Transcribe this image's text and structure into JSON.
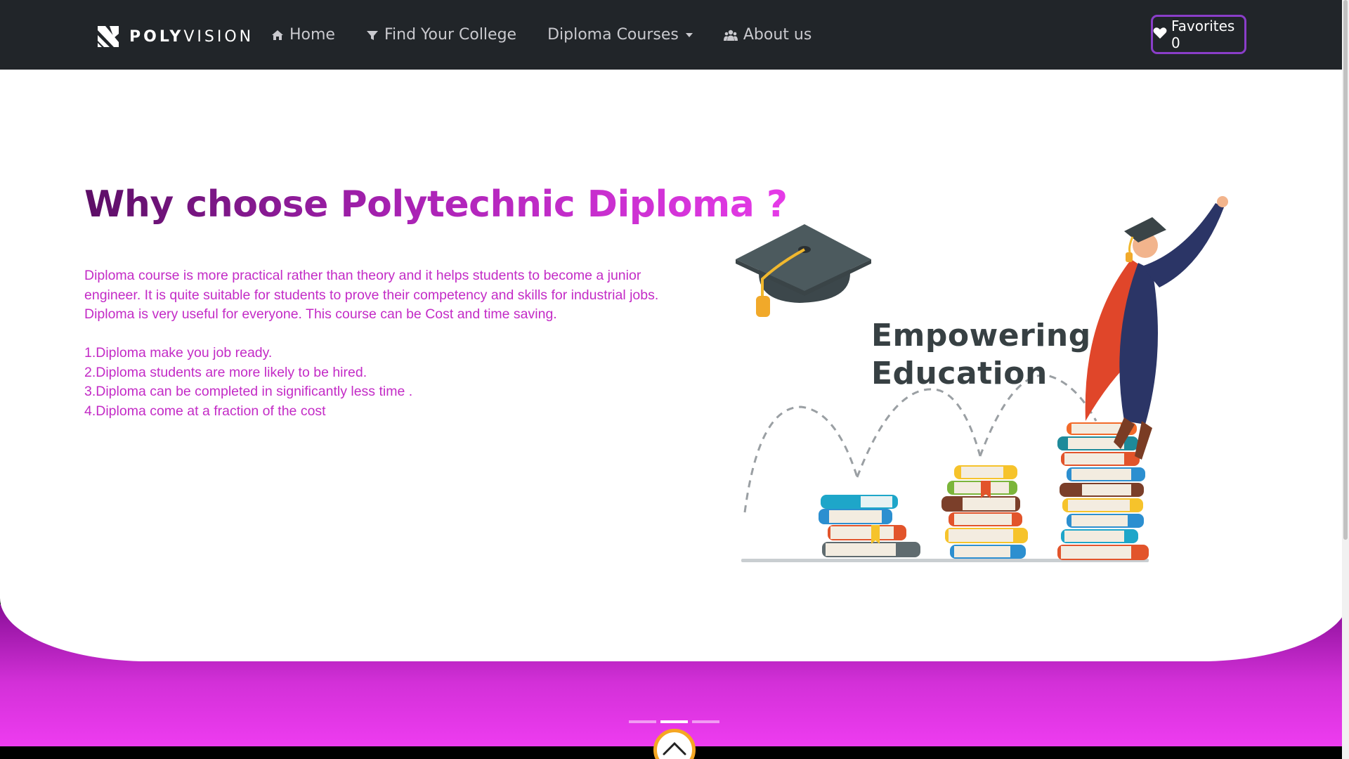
{
  "brand": {
    "name_bold": "POLY",
    "name_light": "VISION",
    "logo_icon": "polyvision-x-logo"
  },
  "nav": {
    "items": [
      {
        "label": "Home",
        "icon": "home-icon"
      },
      {
        "label": "Find Your College",
        "icon": "filter-icon"
      },
      {
        "label": "Diploma Courses",
        "icon": "caret-down-icon"
      },
      {
        "label": "About us",
        "icon": "users-icon"
      }
    ],
    "favorites_label": "Favorites 0",
    "favorites_icon": "heart-icon"
  },
  "hero": {
    "title": "Why choose Polytechnic Diploma ?",
    "paragraph_1": "Diploma course is more practical rather than theory and it helps students to become a junior engineer. It is quite suitable for students to prove their competency and skills for industrial jobs.",
    "paragraph_2": "Diploma is very useful for everyone. This course can be Cost and time saving.",
    "points": [
      "1.Diploma make you job ready.",
      "2.Diploma students are more likely to be hired.",
      "3.Diploma can be completed in significantly less time .",
      "4.Diploma come at a fraction of the cost"
    ]
  },
  "illustration": {
    "heading_line1": "Empowering",
    "heading_line2": "Education"
  },
  "carousel": {
    "indicator_count": 3,
    "active_index": 1
  },
  "colors": {
    "navbar_bg": "#212529",
    "accent_purple": "#8a3ec9",
    "text_magenta": "#c32bc6",
    "gradient_dark": "#8a0f98",
    "gradient_light": "#ee3cf0",
    "scroll_ring": "#f5a623"
  }
}
